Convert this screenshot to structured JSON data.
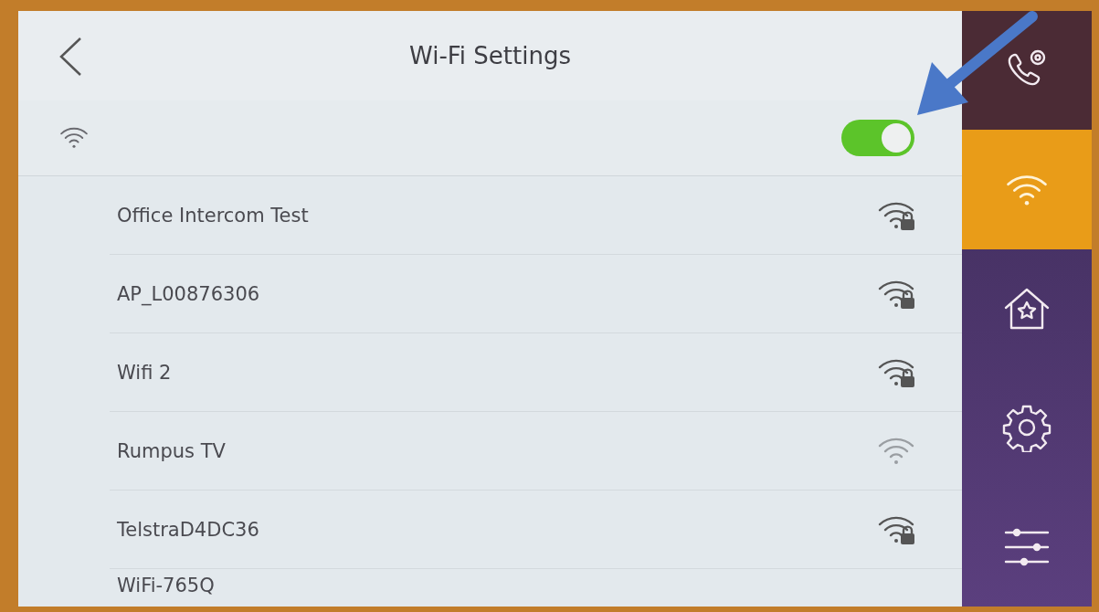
{
  "header": {
    "title": "Wi-Fi Settings"
  },
  "wifi_toggle": {
    "on": true
  },
  "networks": [
    {
      "name": "Office Intercom Test",
      "locked": true
    },
    {
      "name": "AP_L00876306",
      "locked": true
    },
    {
      "name": "Wifi 2",
      "locked": true
    },
    {
      "name": "Rumpus TV",
      "locked": false
    },
    {
      "name": "TelstraD4DC36",
      "locked": true
    },
    {
      "name": "WiFi-765Q"
    }
  ],
  "sidebar": {
    "items": [
      {
        "kind": "call-settings",
        "selected": false
      },
      {
        "kind": "wifi",
        "selected": true
      },
      {
        "kind": "home",
        "selected": false
      },
      {
        "kind": "settings",
        "selected": false
      },
      {
        "kind": "sliders",
        "selected": false
      }
    ]
  }
}
